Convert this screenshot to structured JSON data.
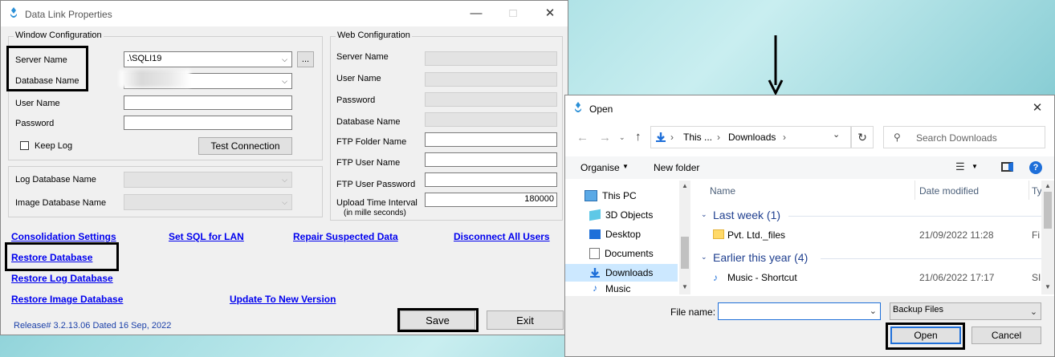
{
  "dlp": {
    "title": "Data Link Properties",
    "window_config": {
      "title": "Window Configuration",
      "server_name_label": "Server Name",
      "server_name_value": ".\\SQLI19",
      "browse_label": "...",
      "database_name_label": "Database Name",
      "user_name_label": "User Name",
      "password_label": "Password",
      "keep_log_label": "Keep Log",
      "test_connection_label": "Test Connection"
    },
    "log_db_label": "Log Database Name",
    "image_db_label": "Image Database Name",
    "web_config": {
      "title": "Web Configuration",
      "server_name_label": "Server Name",
      "user_name_label": "User Name",
      "password_label": "Password",
      "database_name_label": "Database Name",
      "ftp_folder_label": "FTP Folder Name",
      "ftp_user_label": "FTP User Name",
      "ftp_password_label": "FTP User Password",
      "upload_label": "Upload Time Interval",
      "upload_sub_label": "(in mille seconds)",
      "upload_value": "180000"
    },
    "links": {
      "consolidation": "Consolidation Settings",
      "set_sql": "Set SQL for LAN",
      "repair": "Repair Suspected Data",
      "disconnect": "Disconnect All Users",
      "restore_db": "Restore Database",
      "restore_log": "Restore Log Database",
      "restore_image": "Restore Image Database",
      "update": "Update To New Version"
    },
    "release": "Release# 3.2.13.06  Dated 16 Sep, 2022",
    "save_label": "Save",
    "exit_label": "Exit"
  },
  "open": {
    "title": "Open",
    "breadcrumb": [
      "This ...",
      "Downloads"
    ],
    "search_placeholder": "Search Downloads",
    "organise_label": "Organise",
    "new_folder_label": "New folder",
    "help_label": "?",
    "tree": [
      "This PC",
      "3D Objects",
      "Desktop",
      "Documents",
      "Downloads",
      "Music"
    ],
    "columns": {
      "name": "Name",
      "date": "Date modified",
      "type": "Ty"
    },
    "groups": [
      {
        "header": "Last week (1)",
        "files": [
          {
            "name": "Pvt. Ltd._files",
            "date": "21/09/2022 11:28",
            "type": "Fi"
          }
        ]
      },
      {
        "header": "Earlier this year (4)",
        "files": [
          {
            "name": "Music - Shortcut",
            "date": "21/06/2022 17:17",
            "type": "SI"
          }
        ]
      }
    ],
    "file_name_label": "File name:",
    "file_name_value": "",
    "file_type_value": "Backup Files",
    "open_label": "Open",
    "cancel_label": "Cancel"
  }
}
